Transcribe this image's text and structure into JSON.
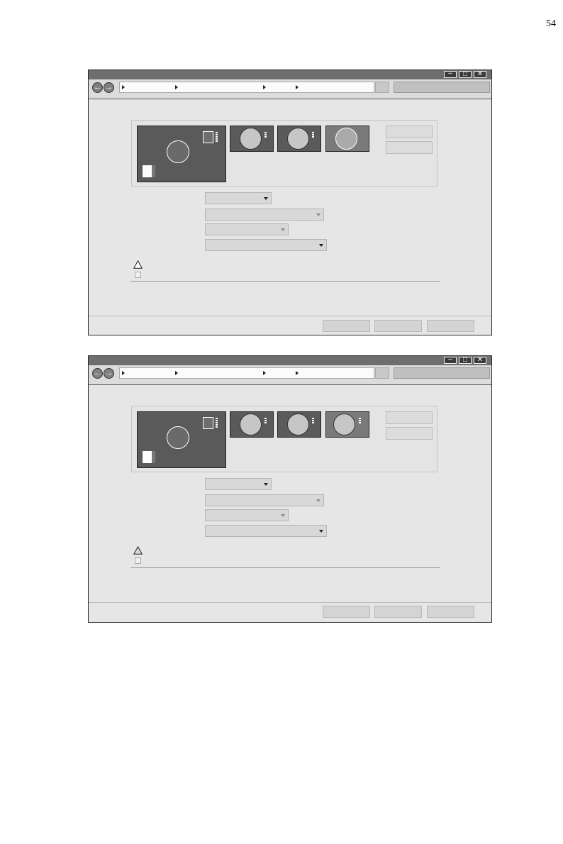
{
  "page_number": "54",
  "colors": {
    "titlebar": "#6e6e6e",
    "window_bg": "#e6e6e6",
    "monitor_fill": "#5a5a5a",
    "selected_monitor_fill": "#7a7a7a"
  },
  "icons": {
    "back": "left-arrow-icon",
    "forward": "right-arrow-icon",
    "warning": "warning-triangle-icon",
    "minimize": "minimize-icon",
    "maximize": "maximize-icon",
    "close": "close-icon"
  },
  "windows": [
    {
      "titlebar": {
        "minimize": "–",
        "maximize": "□",
        "close": "✕"
      },
      "nav": {
        "back": "←",
        "forward": "→"
      },
      "monitors": [
        {
          "number": ""
        },
        {
          "number": ""
        },
        {
          "number": ""
        },
        {
          "number": ""
        }
      ],
      "side_buttons": [
        "",
        ""
      ],
      "dropdowns": [
        "",
        "",
        "",
        ""
      ],
      "warning_text": "",
      "checkbox_label": "",
      "footer_buttons": [
        "",
        "",
        ""
      ]
    },
    {
      "titlebar": {
        "minimize": "–",
        "maximize": "□",
        "close": "✕"
      },
      "nav": {
        "back": "←",
        "forward": "→"
      },
      "monitors": [
        {
          "number": ""
        },
        {
          "number": ""
        },
        {
          "number": ""
        },
        {
          "number": ""
        }
      ],
      "side_buttons": [
        "",
        ""
      ],
      "dropdowns": [
        "",
        "",
        "",
        ""
      ],
      "warning_text": "",
      "checkbox_label": "",
      "footer_buttons": [
        "",
        "",
        ""
      ]
    }
  ]
}
